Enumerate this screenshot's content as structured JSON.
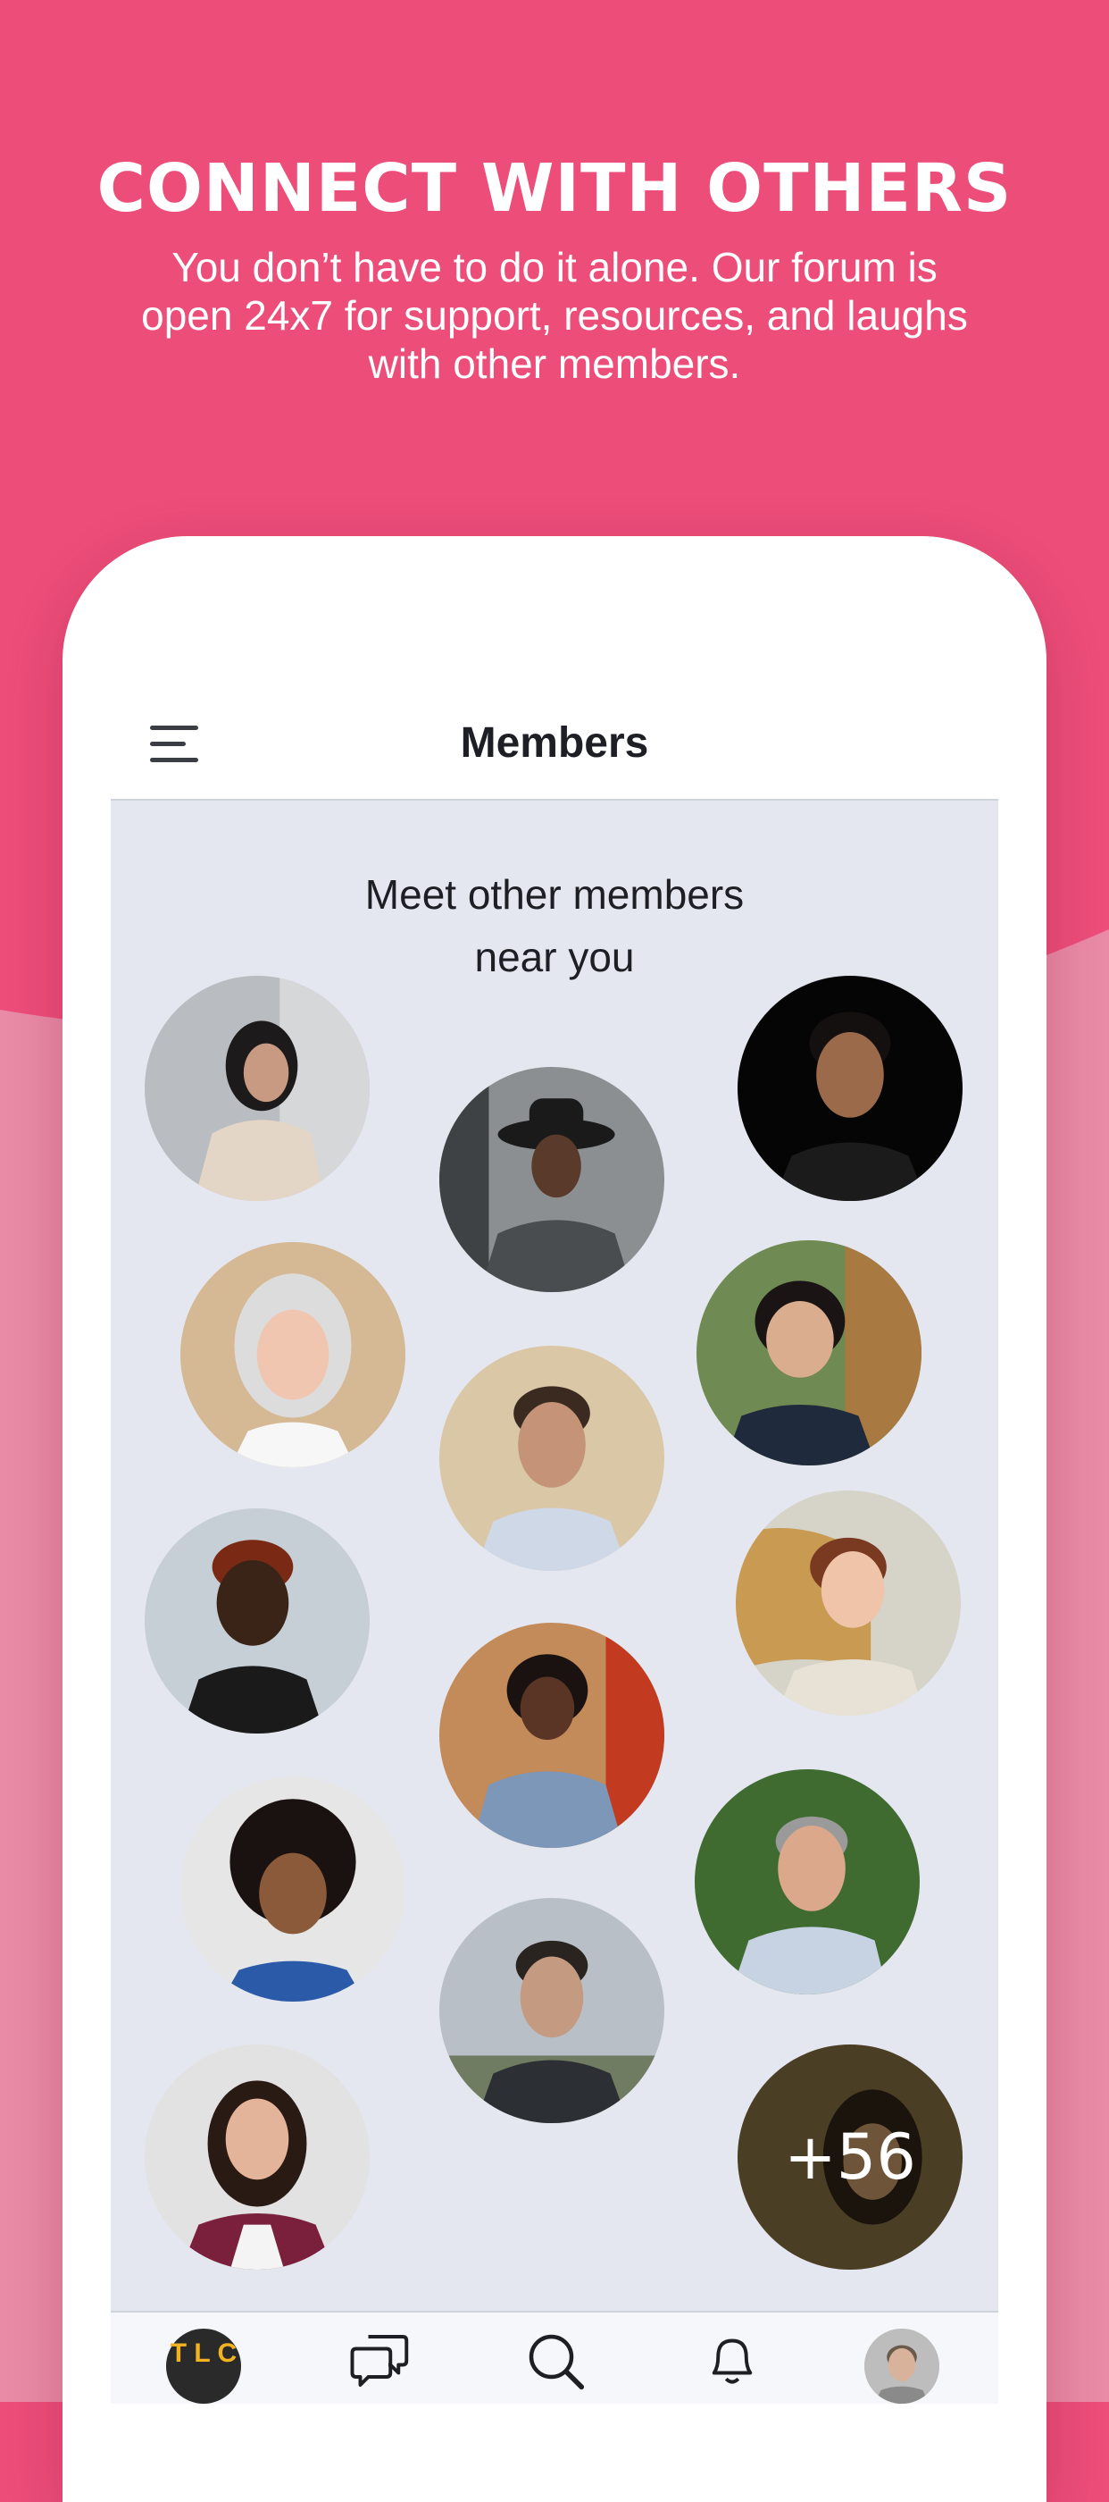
{
  "hero": {
    "headline": "CONNECT WITH OTHERS",
    "subline": "You don’t have to do it alone. Our forum is open 24x7 for support, resources, and laughs with other members."
  },
  "screen": {
    "title": "Members",
    "menu_icon": "hamburger-icon",
    "prompt": "Meet other members\nnear you",
    "more_count": "+56"
  },
  "tabbar": {
    "items": [
      {
        "name": "home",
        "icon": "tlc-logo-icon",
        "logo_text": "T L C"
      },
      {
        "name": "forum",
        "icon": "chat-bubbles-icon"
      },
      {
        "name": "search",
        "icon": "search-icon"
      },
      {
        "name": "notifications",
        "icon": "bell-icon"
      },
      {
        "name": "profile",
        "icon": "avatar-icon"
      }
    ]
  },
  "colors": {
    "brand_pink": "#ec4d79",
    "lower_pink": "#e98aa6",
    "content_bg": "#e4e7ef",
    "logo_yellow": "#f2b321"
  }
}
